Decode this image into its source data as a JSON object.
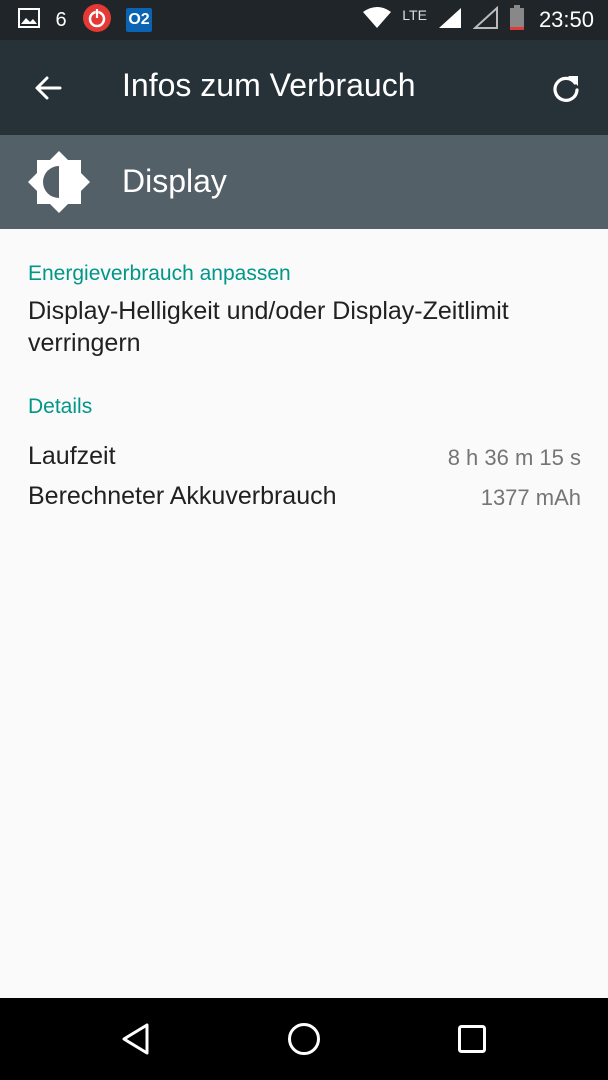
{
  "status_bar": {
    "notification_count": "6",
    "carrier_logo": "O2",
    "network_type": "LTE",
    "time": "23:50",
    "icons": [
      "image-notification-icon",
      "stopwatch-count-icon",
      "power-app-icon",
      "o2-carrier-icon",
      "wifi-icon",
      "signal-icon",
      "signal-empty-icon",
      "battery-icon"
    ]
  },
  "toolbar": {
    "title": "Infos zum Verbrauch",
    "back_icon": "arrow-left-icon",
    "refresh_icon": "refresh-icon"
  },
  "header": {
    "icon": "brightness-icon",
    "label": "Display"
  },
  "sections": {
    "tip_title": "Energieverbrauch anpassen",
    "tip_text": "Display-Helligkeit und/oder Display-Zeitlimit verringern",
    "details_title": "Details"
  },
  "details": [
    {
      "key": "Laufzeit",
      "value": "8 h 36 m 15 s"
    },
    {
      "key": "Berechneter Akkuverbrauch",
      "value": "1377 mAh"
    }
  ],
  "colors": {
    "accent": "#009688",
    "toolbar": "#263238",
    "header": "#546067"
  },
  "nav_bar": {
    "icons": [
      "back-triangle-icon",
      "home-circle-icon",
      "recents-square-icon"
    ]
  }
}
